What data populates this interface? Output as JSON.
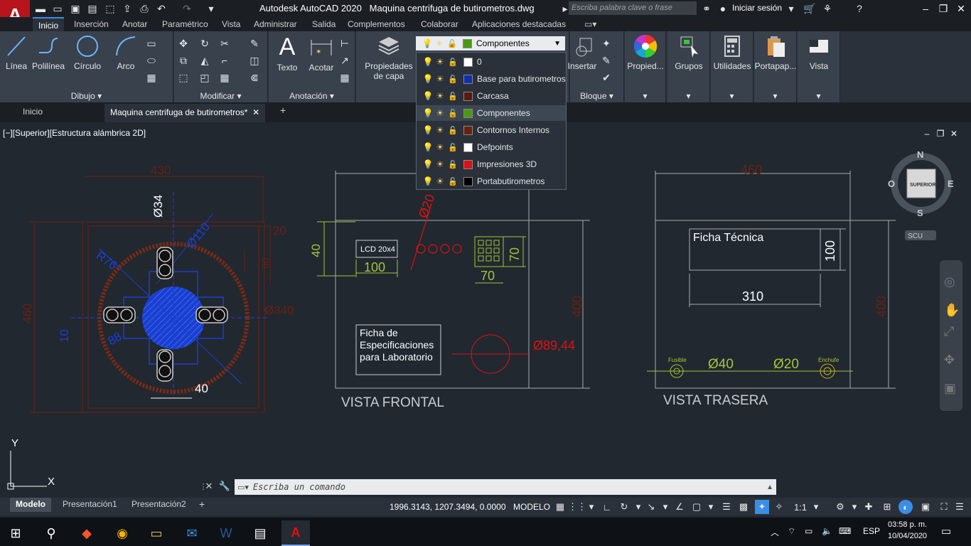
{
  "titlebar": {
    "app_logo": "A",
    "app_name": "Autodesk AutoCAD 2020",
    "filename": "Maquina centrifuga de butirometros.dwg",
    "search_placeholder": "Escriba palabra clave o frase",
    "signin": "Iniciar sesión"
  },
  "ribbon_tabs": [
    "Inicio",
    "Inserción",
    "Anotar",
    "Paramétrico",
    "Vista",
    "Administrar",
    "Salida",
    "Complementos",
    "Colaborar",
    "Aplicaciones destacadas"
  ],
  "ribbon": {
    "draw": {
      "title": "Dibujo",
      "line": "Línea",
      "polyline": "Polilínea",
      "circle": "Círculo",
      "arc": "Arco"
    },
    "modify": {
      "title": "Modificar"
    },
    "annotation": {
      "title": "Anotación",
      "text": "Texto",
      "dimension": "Acotar"
    },
    "layers": {
      "properties_line1": "Propiedades",
      "properties_line2": "de capa",
      "current_layer": "Componentes"
    },
    "block": {
      "title": "Bloque",
      "insert": "Insertar"
    },
    "properties": "Propied...",
    "groups": "Grupos",
    "utilities": "Utilidades",
    "clipboard": "Portapap...",
    "view": "Vista"
  },
  "layer_list": [
    {
      "name": "0",
      "color": "#ffffff"
    },
    {
      "name": "Base para butirometros",
      "color": "#1030b0"
    },
    {
      "name": "Carcasa",
      "color": "#5a1a10"
    },
    {
      "name": "Componentes",
      "color": "#4a9a10"
    },
    {
      "name": "Contornos Internos",
      "color": "#6a2010"
    },
    {
      "name": "Defpoints",
      "color": "#ffffff"
    },
    {
      "name": "Impresiones 3D",
      "color": "#e01010"
    },
    {
      "name": "Portabutirometros",
      "color": "#000000"
    }
  ],
  "doc_tabs": {
    "home": "Inicio",
    "drawing": "Maquina centrifuga de butirometros*"
  },
  "viewport_label": "[−][Superior][Estructura alámbrica 2D]",
  "viewcube": {
    "n": "N",
    "s": "S",
    "e": "E",
    "w": "O",
    "face": "SUPERIOR",
    "ucs": "SCU"
  },
  "drawing": {
    "dim_430": "430",
    "dim_460_left": "460",
    "dim_34": "Ø34",
    "dim_110": "Ø110",
    "dim_r76": "R76",
    "dim_20a": "20",
    "dim_60": "60",
    "dim_340": "Ø340",
    "dim_10": "10",
    "dim_88": "88",
    "dim_40_bottom": "40",
    "lcd": "LCD 20x4",
    "dim_40_lcd": "40",
    "dim_100_lcd": "100",
    "dim_20_red": "Ø20",
    "dim_70a": "70",
    "dim_70b": "70",
    "spec_text_1": "Ficha de",
    "spec_text_2": "Especificaciones",
    "spec_text_3": "para Laboratorio",
    "dim_8944": "Ø89,44",
    "dim_400_front": "400",
    "front_title": "VISTA FRONTAL",
    "dim_460_right": "460",
    "tech_sheet": "Ficha Técnica",
    "dim_100_right": "100",
    "dim_310": "310",
    "dim_400_rear": "400",
    "fuse": "Fusible",
    "dim_40_fuse": "Ø40",
    "dim_20_plug": "Ø20",
    "plug": "Enchufe",
    "rear_title": "VISTA TRASERA",
    "axis_y": "Y",
    "axis_x": "X"
  },
  "command_placeholder": "Escriba un comando",
  "layout_tabs": [
    "Modelo",
    "Presentación1",
    "Presentación2"
  ],
  "status": {
    "coords": "1996.3143, 1207.3494, 0.0000",
    "model": "MODELO",
    "scale": "1:1"
  },
  "taskbar": {
    "lang": "ESP",
    "time": "03:58 p. m.",
    "date": "10/04/2020"
  },
  "colors": {
    "accent": "#3a8ee6",
    "autocad_red": "#b7141d",
    "dim_red": "#e01010",
    "dim_blue": "#1a3fd0",
    "green": "#a8c23a",
    "brown": "#6a2010"
  }
}
